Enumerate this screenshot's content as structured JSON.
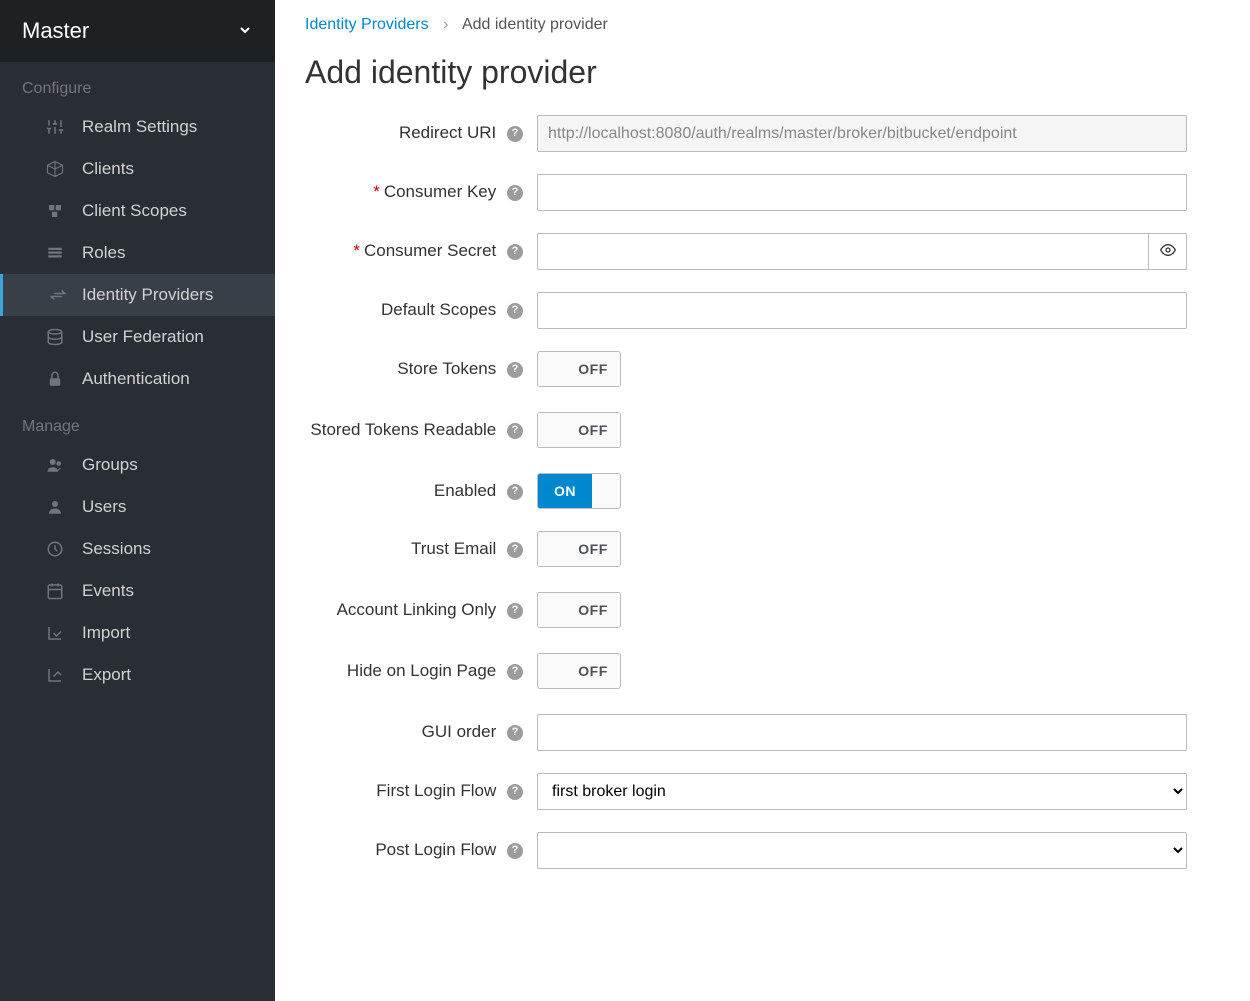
{
  "realm": "Master",
  "sidebar": {
    "sections": [
      {
        "header": "Configure",
        "items": [
          {
            "label": "Realm Settings"
          },
          {
            "label": "Clients"
          },
          {
            "label": "Client Scopes"
          },
          {
            "label": "Roles"
          },
          {
            "label": "Identity Providers"
          },
          {
            "label": "User Federation"
          },
          {
            "label": "Authentication"
          }
        ]
      },
      {
        "header": "Manage",
        "items": [
          {
            "label": "Groups"
          },
          {
            "label": "Users"
          },
          {
            "label": "Sessions"
          },
          {
            "label": "Events"
          },
          {
            "label": "Import"
          },
          {
            "label": "Export"
          }
        ]
      }
    ]
  },
  "breadcrumb": {
    "parent": "Identity Providers",
    "current": "Add identity provider"
  },
  "page_title": "Add identity provider",
  "form": {
    "redirect_uri": {
      "label": "Redirect URI",
      "value": "http://localhost:8080/auth/realms/master/broker/bitbucket/endpoint"
    },
    "consumer_key": {
      "label": "Consumer Key",
      "value": ""
    },
    "consumer_secret": {
      "label": "Consumer Secret",
      "value": ""
    },
    "default_scopes": {
      "label": "Default Scopes",
      "value": ""
    },
    "store_tokens": {
      "label": "Store Tokens",
      "state": "OFF"
    },
    "stored_tokens_readable": {
      "label": "Stored Tokens Readable",
      "state": "OFF"
    },
    "enabled": {
      "label": "Enabled",
      "state": "ON"
    },
    "trust_email": {
      "label": "Trust Email",
      "state": "OFF"
    },
    "account_linking_only": {
      "label": "Account Linking Only",
      "state": "OFF"
    },
    "hide_on_login_page": {
      "label": "Hide on Login Page",
      "state": "OFF"
    },
    "gui_order": {
      "label": "GUI order",
      "value": ""
    },
    "first_login_flow": {
      "label": "First Login Flow",
      "value": "first broker login"
    },
    "post_login_flow": {
      "label": "Post Login Flow",
      "value": ""
    }
  },
  "toggle_labels": {
    "on": "ON",
    "off": "OFF"
  }
}
